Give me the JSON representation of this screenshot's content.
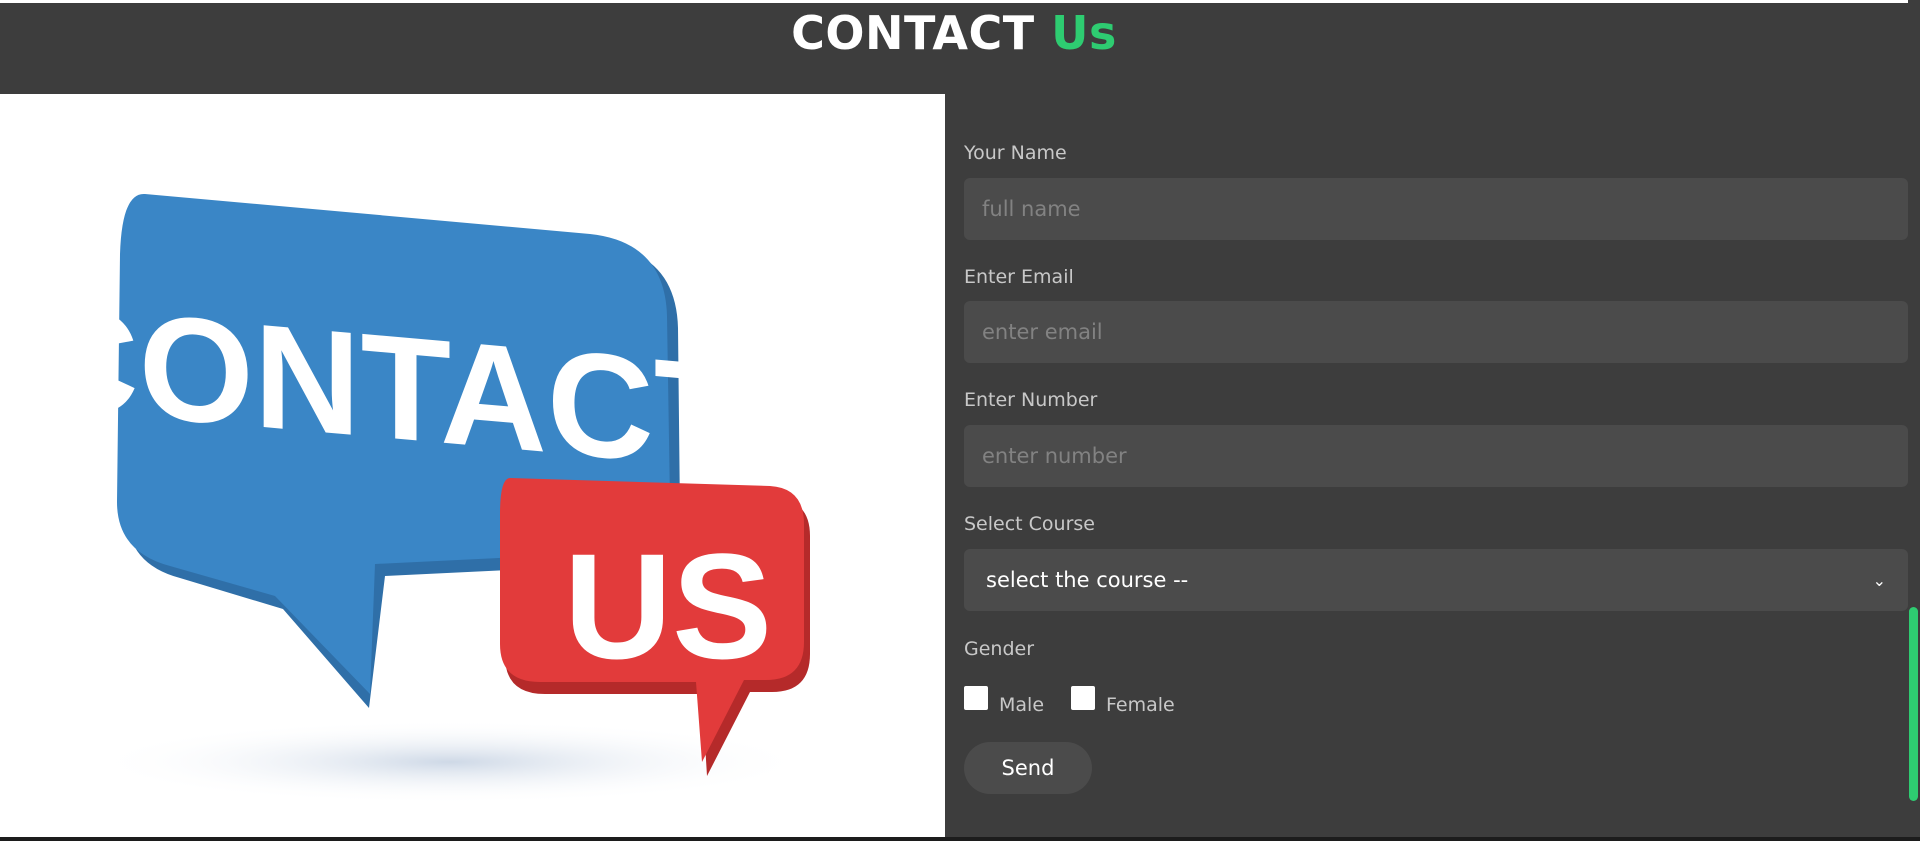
{
  "header": {
    "title_main": "CONTACT",
    "title_accent": "Us"
  },
  "image": {
    "bubble_big_text": "CONTACT",
    "bubble_small_text": "US",
    "colors": {
      "blue": "#3a86c6",
      "red": "#e23b3b"
    }
  },
  "form": {
    "name_label": "Your Name",
    "name_placeholder": "full name",
    "email_label": "Enter Email",
    "email_placeholder": "enter email",
    "number_label": "Enter Number",
    "number_placeholder": "enter number",
    "course_label": "Select Course",
    "course_selected": "select the course --",
    "gender_label": "Gender",
    "gender_options": [
      "Male",
      "Female"
    ],
    "send_label": "Send"
  },
  "colors": {
    "background": "#3d3d3d",
    "input": "#4b4b4b",
    "accent": "#2ecc71"
  }
}
